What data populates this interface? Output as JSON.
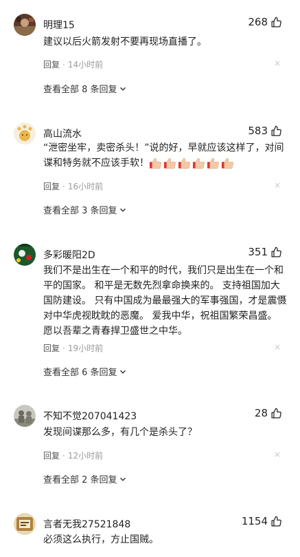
{
  "comments": [
    {
      "username": "明理15",
      "likes": "268",
      "content": "建议以后火箭发射不要再现场直播了。",
      "reply_label": "回复",
      "dot": "·",
      "time": "14小时前",
      "dismiss": "×",
      "view_replies": "查看全部 8 条回复"
    },
    {
      "username": "高山流水",
      "likes": "583",
      "content": "“泄密坐牢，卖密杀头！”说的好，早就应该这样了，对间谍和特务就不应该手软！",
      "emoji_count": 6,
      "reply_label": "回复",
      "dot": "·",
      "time": "16小时前",
      "dismiss": "×",
      "view_replies": "查看全部 3 条回复"
    },
    {
      "username": "多彩暖阳2D",
      "likes": "351",
      "content": "我们不是出生在一个和平的时代，我们只是出生在一个和平的国家。 和平是无数先烈拿命换来的。 支持祖国加大国防建设。 只有中国成为最最强大的军事强国，才是震慑对中华虎视眈眈的恶魔。 爱我中华，祝祖国繁荣昌盛。 愿以吾辈之青春捍卫盛世之中华。",
      "reply_label": "回复",
      "dot": "·",
      "time": "19小时前",
      "dismiss": "×",
      "view_replies": "查看全部 6 条回复"
    },
    {
      "username": "不知不觉207041423",
      "likes": "28",
      "content": "发现间谍那么多，有几个是杀头了？",
      "reply_label": "回复",
      "dot": "·",
      "time": "12小时前",
      "dismiss": "×",
      "view_replies": "查看全部 2 条回复"
    },
    {
      "username": "言者无我27521848",
      "likes": "1154",
      "content": "必须这么执行，方止国贼。"
    }
  ],
  "colors": {
    "text": "#222222",
    "meta": "#999999",
    "emoji_thumb": "#f4c9a6",
    "emoji_red": "#e2362f"
  },
  "icons": {
    "like": "thumbs-up-outline-icon",
    "dismiss": "close-icon",
    "expand": "chevron-down-icon",
    "emoji": "thumbs-up-emoji"
  }
}
